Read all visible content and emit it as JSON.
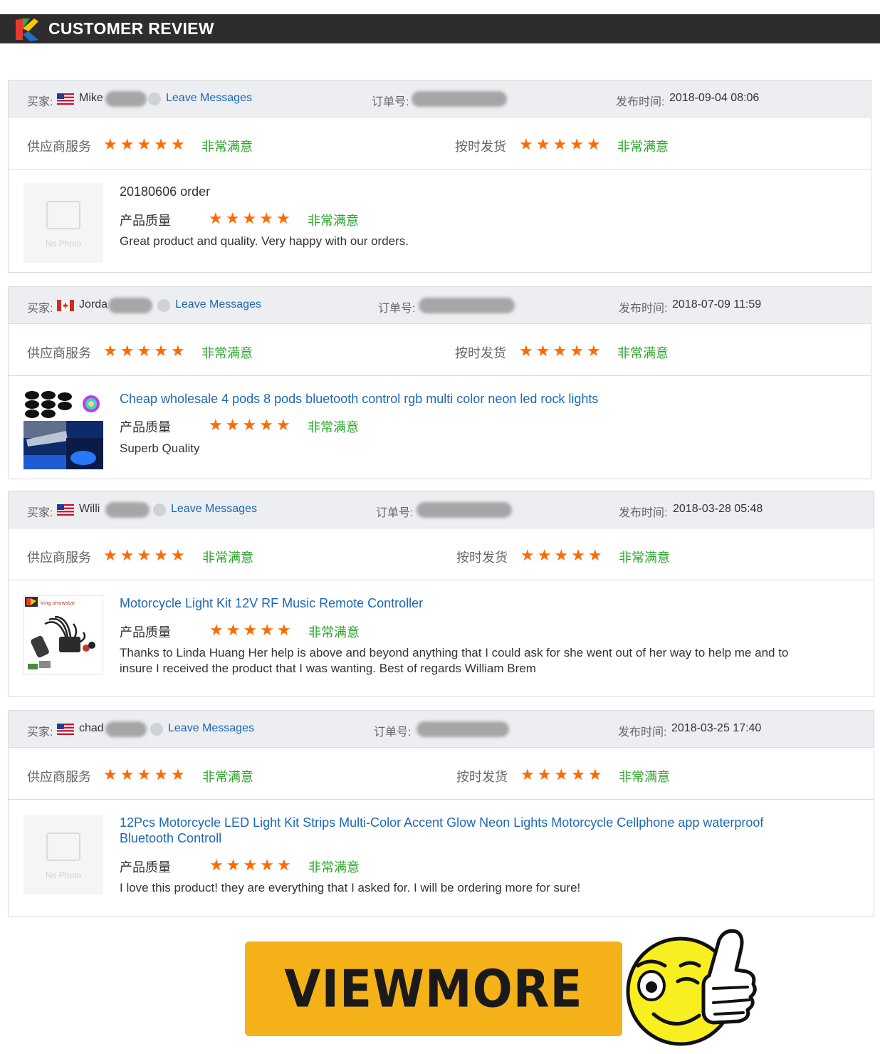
{
  "header": {
    "title": "CUSTOMER REVIEW"
  },
  "labels": {
    "buyer": "买家:",
    "order_no": "订单号:",
    "published": "发布时间:",
    "supplier_service": "供应商服务",
    "on_time_delivery": "按时发货",
    "product_quality": "产品质量",
    "rating_text": "非常满意",
    "leave_messages": "Leave Messages",
    "no_photo": "No Photo"
  },
  "reviews": [
    {
      "buyer": "Mike",
      "country": "US",
      "date": "2018-09-04 08:06",
      "supplier_rating": 5,
      "delivery_rating": 5,
      "quality_rating": 5,
      "product": "20180606 order",
      "comment": "Great product and quality. Very happy with our orders.",
      "thumbnail": "no-photo"
    },
    {
      "buyer": "Jorda",
      "country": "CA",
      "date": "2018-07-09 11:59",
      "supplier_rating": 5,
      "delivery_rating": 5,
      "quality_rating": 5,
      "product": "Cheap wholesale 4 pods 8 pods bluetooth control rgb multi color neon led rock lights",
      "comment": "Superb Quality",
      "thumbnail": "rock-lights-photo"
    },
    {
      "buyer": "Willi",
      "country": "US",
      "date": "2018-03-28 05:48",
      "supplier_rating": 5,
      "delivery_rating": 5,
      "quality_rating": 5,
      "product": "Motorcycle Light Kit 12V RF Music Remote Controller",
      "comment": "Thanks to Linda Huang Her help is above and beyond anything that I could ask for she went out of her way to help me and to insure I received the product that I was wanting. Best of regards William Brem",
      "thumbnail": "motorcycle-kit-photo"
    },
    {
      "buyer": "chad",
      "country": "US",
      "date": "2018-03-25 17:40",
      "supplier_rating": 5,
      "delivery_rating": 5,
      "quality_rating": 5,
      "product": "12Pcs Motorcycle LED Light Kit Strips Multi-Color Accent Glow Neon Lights Motorcycle Cellphone app waterproof Bluetooth Controll",
      "comment": "I love this product! they are everything that I asked for. I will be ordering more for sure!",
      "thumbnail": "no-photo"
    }
  ],
  "view_more": {
    "label": "VIEWMORE"
  },
  "colors": {
    "accent_link": "#1d67b7",
    "star": "#ff6a00",
    "rating_text": "#2ca52c",
    "button": "#f4b218",
    "header_bg": "#2d2d2d"
  }
}
